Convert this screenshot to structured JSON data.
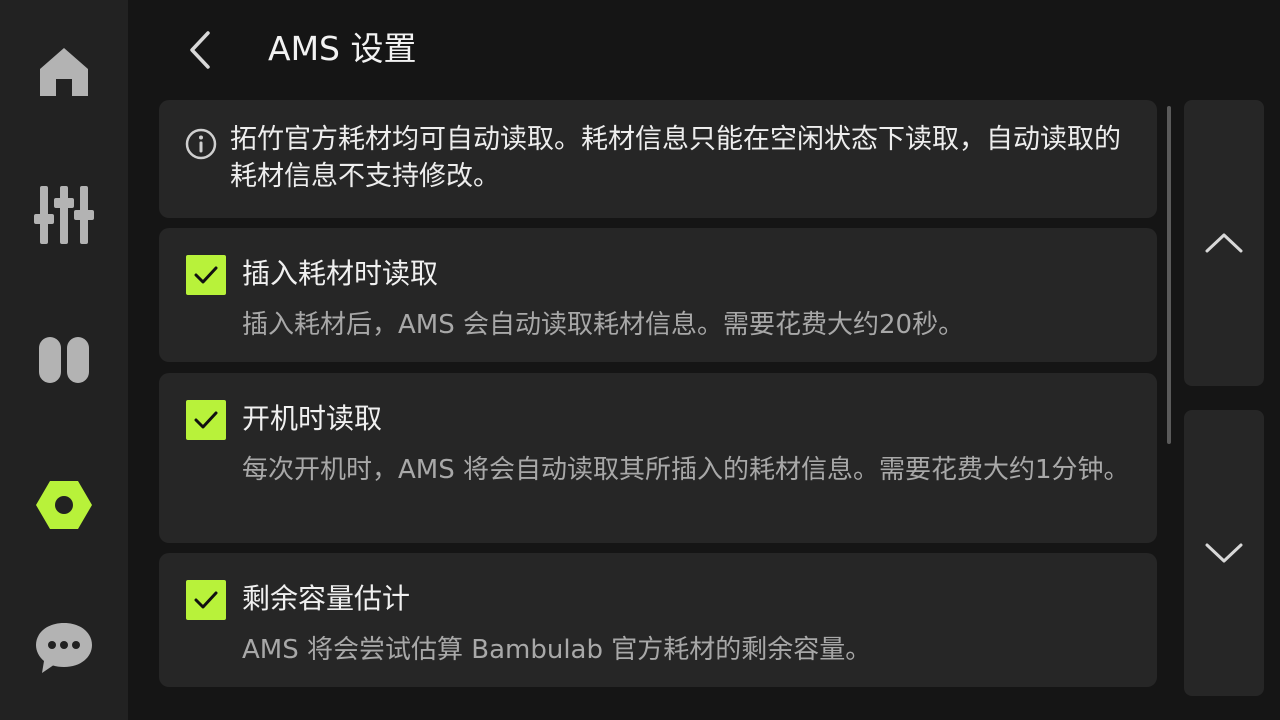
{
  "header": {
    "title": "AMS 设置"
  },
  "sidebar": {
    "items": [
      {
        "icon": "home-icon",
        "active": false
      },
      {
        "icon": "sliders-icon",
        "active": false
      },
      {
        "icon": "filament-icon",
        "active": false
      },
      {
        "icon": "settings-hex-icon",
        "active": true
      },
      {
        "icon": "chat-icon",
        "active": false
      }
    ]
  },
  "info": {
    "text": "拓竹官方耗材均可自动读取。耗材信息只能在空闲状态下读取，自动读取的耗材信息不支持修改。"
  },
  "options": [
    {
      "title": "插入耗材时读取",
      "description": "插入耗材后，AMS 会自动读取耗材信息。需要花费大约20秒。",
      "checked": true
    },
    {
      "title": "开机时读取",
      "description": "每次开机时，AMS 将会自动读取其所插入的耗材信息。需要花费大约1分钟。",
      "checked": true
    },
    {
      "title": "剩余容量估计",
      "description": "AMS 将会尝试估算 Bambulab 官方耗材的剩余容量。",
      "checked": true
    }
  ],
  "colors": {
    "accent": "#b8f23a",
    "background": "#151515",
    "sidebar": "#222222",
    "card": "#262626",
    "text_primary": "#f0f0f0",
    "text_secondary": "#a8a8a8"
  }
}
